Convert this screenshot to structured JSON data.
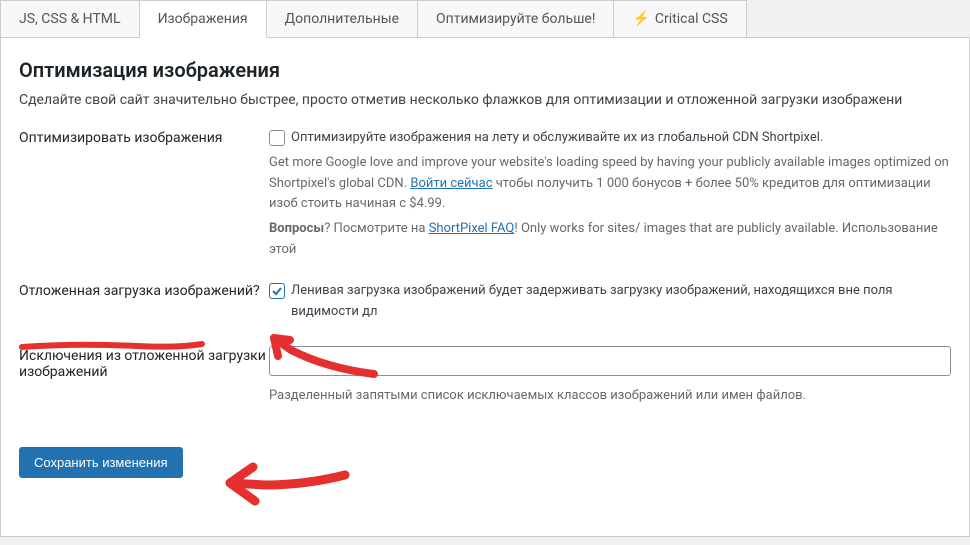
{
  "tabs": {
    "htmlcssjs": "JS, CSS & HTML",
    "images": "Изображения",
    "extra": "Дополнительные",
    "optimize_more": "Оптимизируйте больше!",
    "critical": "Critical CSS"
  },
  "heading": "Оптимизация изображения",
  "intro": "Сделайте свой сайт значительно быстрее, просто отметив несколько флажков для оптимизации и отложенной загрузки изображени",
  "opt_images": {
    "label": "Оптимизировать изображения",
    "checkbox_label": "Оптимизируйте изображения на лету и обслуживайте их из глобальной CDN Shortpixel.",
    "desc1a": "Get more Google love and improve your website's loading speed by having your publicly available images optimized on Shortpixel's global CDN. ",
    "login_link": "Войти сейчас",
    "desc1b": " чтобы получить 1 000 бонусов + более 50% кредитов для оптимизации изоб стоить начиная с $4.99.",
    "q": "Вопросы",
    "q2": "? Посмотрите на ",
    "faq_link": "ShortPixel FAQ",
    "q3": "! Only works for sites/ images that are publicly available. Использование этой"
  },
  "lazy": {
    "label": "Отложенная загрузка изображений?",
    "checkbox_label": "Ленивая загрузка изображений будет задерживать загрузку изображений, находящихся вне поля видимости дл"
  },
  "exclude": {
    "label": "Исключения из отложенной загрузки изображений",
    "value": "",
    "help": "Разделенный запятыми список исключаемых классов изображений или имен файлов."
  },
  "save_btn": "Сохранить изменения"
}
